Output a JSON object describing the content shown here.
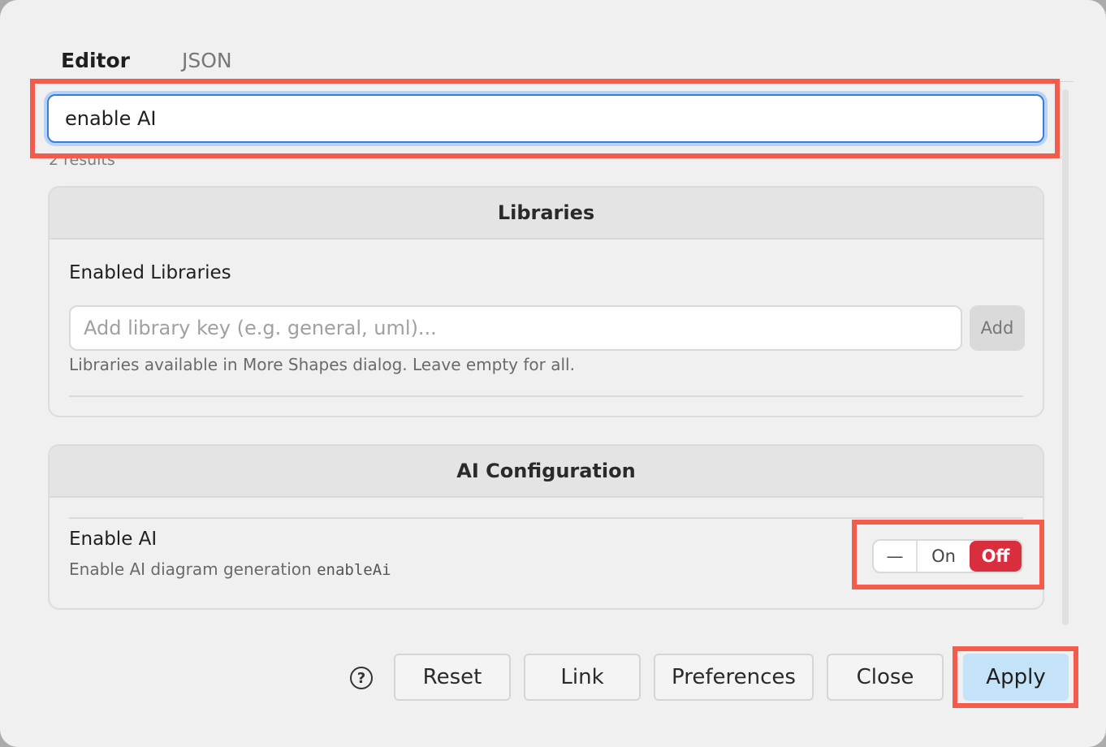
{
  "tabs": [
    {
      "label": "Editor",
      "active": true
    },
    {
      "label": "JSON",
      "active": false
    }
  ],
  "search": {
    "value": "enable AI",
    "results": "2 results"
  },
  "libraries": {
    "header": "Libraries",
    "title": "Enabled Libraries",
    "input_placeholder": "Add library key (e.g. general, uml)...",
    "add_label": "Add",
    "help": "Libraries available in More Shapes dialog. Leave empty for all."
  },
  "ai_config": {
    "header": "AI Configuration",
    "title": "Enable AI",
    "description": "Enable AI diagram generation",
    "key": "enableAi",
    "toggle": {
      "unset_label": "—",
      "on_label": "On",
      "off_label": "Off",
      "selected": "Off"
    }
  },
  "footer": {
    "help_icon": "?",
    "reset": "Reset",
    "link": "Link",
    "preferences": "Preferences",
    "close": "Close",
    "apply": "Apply"
  },
  "colors": {
    "accent": "#3a7be0",
    "off_selected": "#d92e3e",
    "apply_bg": "#c4e3f8",
    "highlight": "#f45b4c"
  }
}
